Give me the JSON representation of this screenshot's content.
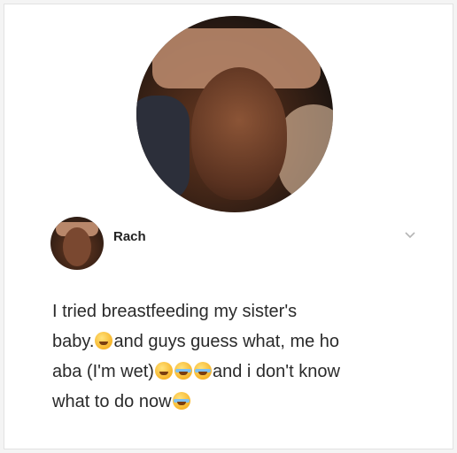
{
  "profile": {
    "name": "Rach"
  },
  "post": {
    "line1": "I tried breastfeeding my sister's",
    "line2_a": "baby.",
    "line2_b": "and guys guess what, me ho",
    "line3_a": "aba (I'm wet)",
    "line3_b": "and i don't know",
    "line4_a": "what to do now"
  },
  "icons": {
    "chevron": "chevron-down-icon",
    "emoji_relieved": "relieved-face-emoji-icon",
    "emoji_weary": "weary-face-emoji-icon",
    "emoji_joy": "tears-of-joy-emoji-icon",
    "emoji_crying": "loudly-crying-emoji-icon"
  },
  "colors": {
    "card_background": "#ffffff",
    "text": "#2a2a2a",
    "emoji_yellow": "#f7b52a"
  }
}
